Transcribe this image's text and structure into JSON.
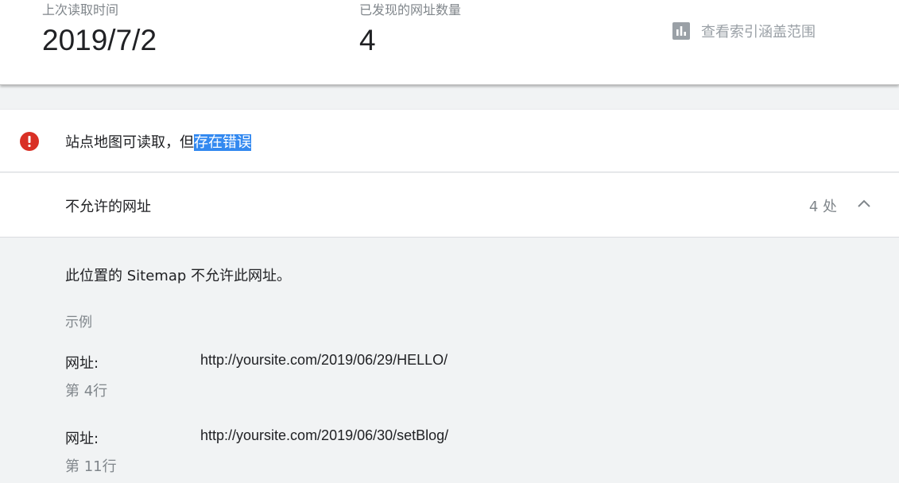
{
  "stats": {
    "last_read_label": "上次读取时间",
    "last_read_value": "2019/7/2",
    "discovered_label": "已发现的网址数量",
    "discovered_value": "4"
  },
  "coverage_link": {
    "label": "查看索引涵盖范围",
    "icon": "bar-chart-icon"
  },
  "status": {
    "icon": "error-icon",
    "text_prefix": "站点地图可读取，但",
    "text_highlight": "存在错误",
    "error_color": "#d93025",
    "highlight_color": "#3389f0"
  },
  "issue": {
    "title": "不允许的网址",
    "count": "4 处",
    "expand_icon": "chevron-up-icon"
  },
  "details": {
    "description": "此位置的 Sitemap 不允许此网址。",
    "examples_label": "示例",
    "examples": [
      {
        "key": "网址:",
        "url": "http://yoursite.com/2019/06/29/HELLO/",
        "line": "第 4行"
      },
      {
        "key": "网址:",
        "url": "http://yoursite.com/2019/06/30/setBlog/",
        "line": "第 11行"
      }
    ]
  }
}
